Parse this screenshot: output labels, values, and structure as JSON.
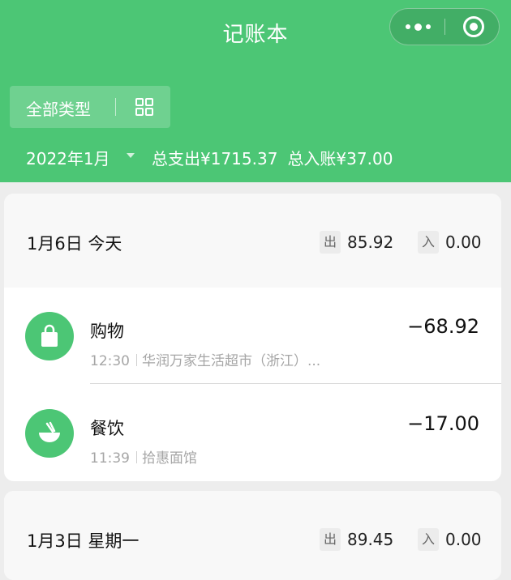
{
  "app": {
    "title": "记账本"
  },
  "header": {
    "filter_label": "全部类型",
    "month": "2022年1月",
    "total_expense": "总支出¥1715.37",
    "total_income": "总入账¥37.00",
    "accent_color": "#4cc675"
  },
  "icons": {
    "capsule_more": "more-dots-icon",
    "capsule_close": "miniapp-close-icon",
    "filter_grid": "grid-icon",
    "month_caret": "caret-down-icon",
    "shopping": "shopping-bag-icon",
    "dining": "bowl-icon"
  },
  "days": [
    {
      "date": "1月6日 今天",
      "out_tag": "出",
      "out_amount": "85.92",
      "in_tag": "入",
      "in_amount": "0.00",
      "transactions": [
        {
          "category": "购物",
          "time": "12:30",
          "merchant": "华润万家生活超市（浙江）...",
          "amount": "−68.92"
        },
        {
          "category": "餐饮",
          "time": "11:39",
          "merchant": "拾惠面馆",
          "amount": "−17.00"
        }
      ]
    },
    {
      "date": "1月3日 星期一",
      "out_tag": "出",
      "out_amount": "89.45",
      "in_tag": "入",
      "in_amount": "0.00"
    }
  ]
}
